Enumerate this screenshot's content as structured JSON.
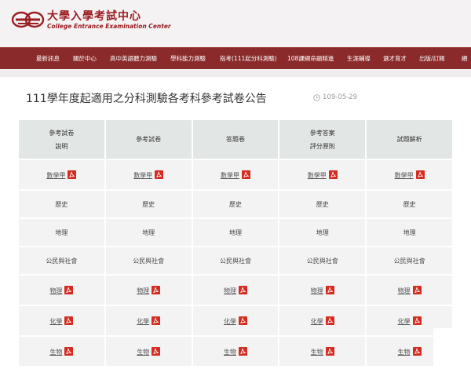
{
  "header": {
    "logo_cn": "大學入學考試中心",
    "logo_en": "College Entrance Examination Center",
    "logo_color": "#9b1e23"
  },
  "nav": {
    "items": [
      "最新訊息",
      "關於中心",
      "高中英語聽力測驗",
      "學科能力測驗",
      "指考(111起分科測驗)",
      "108課綱命題精進",
      "生涯輔導",
      "選才育才",
      "出版/訂閱",
      "網"
    ]
  },
  "page": {
    "title": "111學年度起適用之分科測驗各考科參考試卷公告",
    "date": "109-05-29"
  },
  "table": {
    "headers": [
      [
        "參考試卷",
        "說明"
      ],
      [
        "參考試卷"
      ],
      [
        "答題卷"
      ],
      [
        "參考答案",
        "評分原則"
      ],
      [
        "試題解析"
      ]
    ],
    "rows": [
      {
        "label": "數學甲",
        "links": [
          true,
          true,
          true,
          true,
          true
        ]
      },
      {
        "label": "歷史",
        "links": [
          false,
          false,
          false,
          false,
          false
        ]
      },
      {
        "label": "地理",
        "links": [
          false,
          false,
          false,
          false,
          false
        ]
      },
      {
        "label": "公民與社會",
        "links": [
          false,
          false,
          false,
          false,
          false
        ]
      },
      {
        "label": "物理",
        "links": [
          true,
          true,
          true,
          true,
          true
        ]
      },
      {
        "label": "化學",
        "links": [
          true,
          true,
          true,
          true,
          true
        ]
      },
      {
        "label": "生物",
        "links": [
          true,
          true,
          true,
          true,
          true
        ]
      }
    ]
  },
  "colors": {
    "nav_bg": "#8a2a2a",
    "header_cell_bg": "#e2e6e4",
    "cell_bg": "#f3f3f3",
    "pdf_red": "#d42c21"
  },
  "icons": {
    "pdf": "pdf-icon",
    "clock": "clock-icon"
  }
}
